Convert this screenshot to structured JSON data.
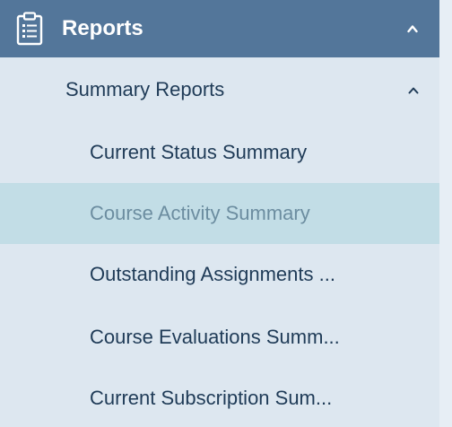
{
  "header": {
    "title": "Reports",
    "icon": "clipboard-icon",
    "toggle_icon": "chevron-up-icon"
  },
  "group": {
    "label": "Summary Reports",
    "toggle_icon": "chevron-up-icon"
  },
  "items": [
    {
      "label": "Current Status Summary",
      "active": false
    },
    {
      "label": "Course Activity Summary",
      "active": true
    },
    {
      "label": "Outstanding Assignments ...",
      "active": false
    },
    {
      "label": "Course Evaluations Summ...",
      "active": false
    },
    {
      "label": "Current Subscription Sum...",
      "active": false
    }
  ],
  "colors": {
    "header_bg": "#53769a",
    "panel_bg": "#dde7f0",
    "active_bg": "#c2dde6",
    "text": "#1f3b57",
    "active_text": "#6c8da0"
  }
}
